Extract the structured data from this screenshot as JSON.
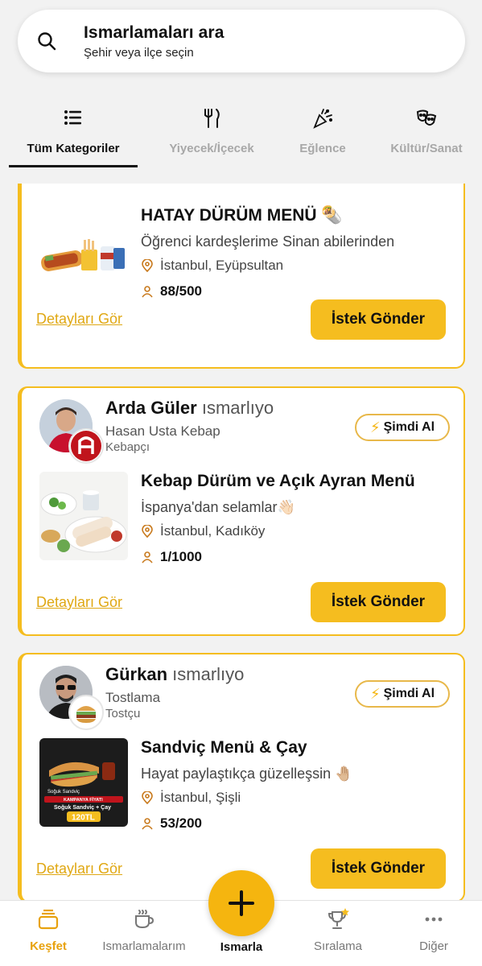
{
  "search": {
    "title": "Ismarlamaları ara",
    "subtitle": "Şehir veya ilçe seçin"
  },
  "categories": [
    {
      "label": "Tüm Kategoriler",
      "icon": "list-icon",
      "active": true
    },
    {
      "label": "Yiyecek/İçecek",
      "icon": "fork-knife-icon",
      "active": false
    },
    {
      "label": "Eğlence",
      "icon": "party-popper-icon",
      "active": false
    },
    {
      "label": "Kültür/Sanat",
      "icon": "theater-masks-icon",
      "active": false
    }
  ],
  "colors": {
    "accent": "#f5bd1f",
    "accent_dark": "#e8a20e",
    "link": "#e0a814"
  },
  "cards": [
    {
      "product_title": "HATAY DÜRÜM MENÜ 🌯",
      "note": "Öğrenci kardeşlerime Sinan abilerinden",
      "location": "İstanbul, Eyüpsultan",
      "count": "88/500",
      "details_label": "Detayları Gör",
      "request_label": "İstek Gönder"
    },
    {
      "sender_name": "Arda Güler",
      "verb": "ısmarlıyo",
      "venue": "Hasan Usta Kebap",
      "venue_type": "Kebapçı",
      "buy_label": "Şimdi Al",
      "product_title": "Kebap Dürüm ve Açık Ayran Menü",
      "note": "İspanya'dan selamlar👋🏻",
      "location": "İstanbul, Kadıköy",
      "count": "1/1000",
      "details_label": "Detayları Gör",
      "request_label": "İstek Gönder"
    },
    {
      "sender_name": "Gürkan",
      "verb": "ısmarlıyo",
      "venue": "Tostlama",
      "venue_type": "Tostçu",
      "buy_label": "Şimdi Al",
      "product_title": "Sandviç Menü & Çay",
      "note": "Hayat paylaştıkça güzelleşsin 🤚🏼",
      "location": "İstanbul, Şişli",
      "count": "53/200",
      "details_label": "Detayları Gör",
      "request_label": "İstek Gönder",
      "image_texts": [
        "Soğuk Sandviç",
        "KAMPANYA FİYATI",
        "Soğuk Sandviç + Çay",
        "120TL"
      ]
    }
  ],
  "tabbar": {
    "items": [
      {
        "label": "Keşfet",
        "icon": "discover-icon",
        "active": true
      },
      {
        "label": "Ismarlamalarım",
        "icon": "coffee-cup-icon",
        "active": false
      },
      {
        "label": "Ismarla",
        "icon": "plus-icon",
        "active": false
      },
      {
        "label": "Sıralama",
        "icon": "trophy-icon",
        "active": false
      },
      {
        "label": "Diğer",
        "icon": "more-dots-icon",
        "active": false
      }
    ]
  }
}
